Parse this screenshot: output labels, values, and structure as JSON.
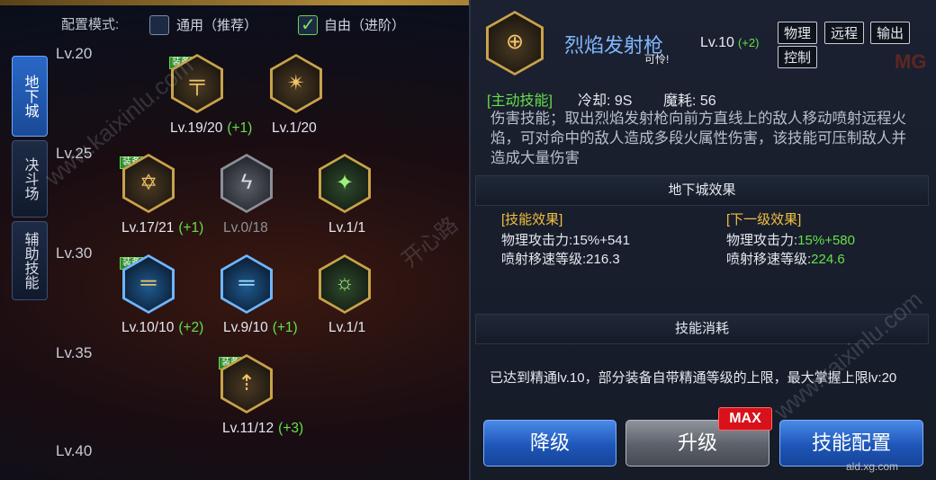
{
  "mode": {
    "label": "配置模式:",
    "options": [
      {
        "label": "通用（推荐）",
        "checked": false
      },
      {
        "label": "自由（进阶）",
        "checked": true
      }
    ]
  },
  "side_tabs": [
    "地下城",
    "决斗场",
    "辅助技能"
  ],
  "levels": [
    "Lv.20",
    "Lv.25",
    "Lv.30",
    "Lv.35",
    "Lv.40"
  ],
  "skills": [
    {
      "icon": "gun-icon",
      "lv": "Lv.19/20",
      "plus": "(+1)",
      "equipped": true
    },
    {
      "icon": "blast-icon",
      "lv": "Lv.1/20",
      "plus": "",
      "equipped": false
    },
    {
      "icon": "rifle-icon",
      "lv": "Lv.17/21",
      "plus": "(+1)",
      "equipped": true
    },
    {
      "icon": "claw-icon",
      "lv": "Lv.0/18",
      "plus": "",
      "equipped": false
    },
    {
      "icon": "laser-icon",
      "lv": "Lv.1/1",
      "plus": "",
      "equipped": false
    },
    {
      "icon": "flamethrower-icon",
      "lv": "Lv.10/10",
      "plus": "(+2)",
      "equipped": true
    },
    {
      "icon": "freeze-gun-icon",
      "lv": "Lv.9/10",
      "plus": "(+1)",
      "equipped": false
    },
    {
      "icon": "plasma-gun-icon",
      "lv": "Lv.1/1",
      "plus": "",
      "equipped": false
    },
    {
      "icon": "rocket-icon",
      "lv": "Lv.11/12",
      "plus": "(+3)",
      "equipped": true
    }
  ],
  "equip_badge": "装备",
  "detail": {
    "name": "烈焰发射枪",
    "lv": "Lv.10",
    "plus": "(+2)",
    "sub": "可怜!",
    "tags": [
      "物理",
      "远程",
      "输出",
      "控制"
    ],
    "active_label": "[主动技能]",
    "cooldown": "冷却: 9S",
    "mp": "魔耗: 56",
    "description": "伤害技能；取出烈焰发射枪向前方直线上的敌人移动喷射远程火焰，可对命中的敌人造成多段火属性伤害，该技能可压制敌人并造成大量伤害"
  },
  "dungeon": {
    "title": "地下城效果",
    "current_label": "[技能效果]",
    "next_label": "[下一级效果]",
    "current": [
      {
        "key": "物理攻击力:",
        "val": "15%+541"
      },
      {
        "key": "喷射移速等级:",
        "val": "216.3"
      }
    ],
    "next": [
      {
        "key": "物理攻击力:",
        "val": "15%+580"
      },
      {
        "key": "喷射移速等级:",
        "val": "224.6"
      }
    ]
  },
  "cost": {
    "title": "技能消耗",
    "note": "已达到精通lv.10，部分装备自带精通等级的上限，最大掌握上限lv:20"
  },
  "buttons": {
    "downgrade": "降级",
    "upgrade": "升级",
    "config": "技能配置",
    "max": "MAX"
  },
  "watermarks": {
    "a": "www.kaixinlu.com",
    "b": "开心路",
    "c": "ald.xg.com",
    "d": "MG"
  },
  "colors": {
    "accent_green": "#66e04a",
    "accent_blue": "#7fb7ff",
    "gold": "#f0c040",
    "max_red": "#d8121a"
  }
}
